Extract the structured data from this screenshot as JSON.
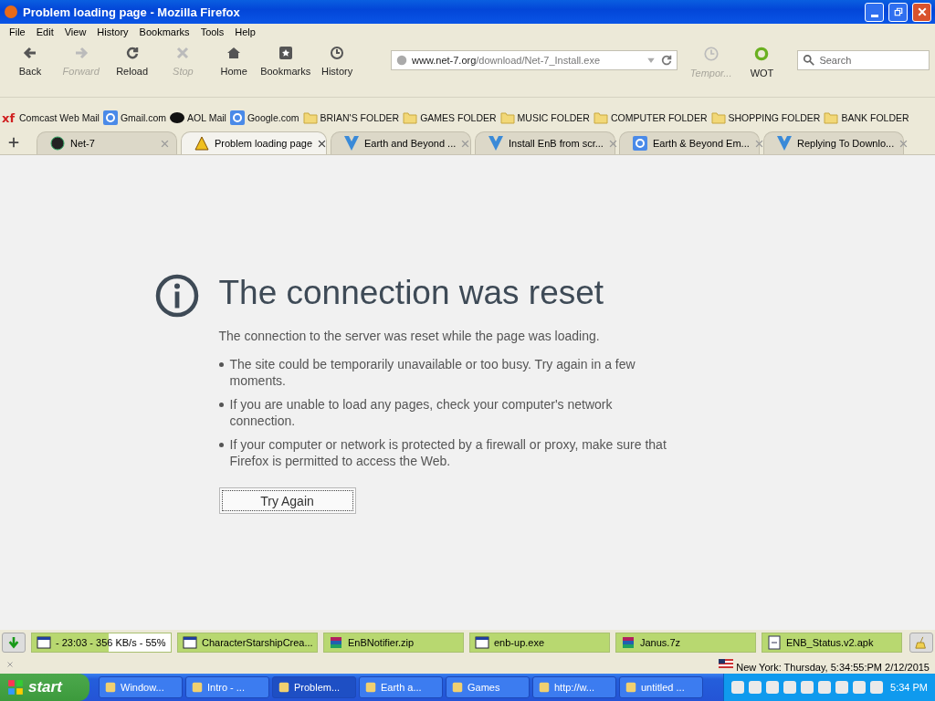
{
  "window": {
    "title": "Problem loading page - Mozilla Firefox"
  },
  "menu": [
    "File",
    "Edit",
    "View",
    "History",
    "Bookmarks",
    "Tools",
    "Help"
  ],
  "toolbar": [
    {
      "kind": "back",
      "label": "Back",
      "disabled": false
    },
    {
      "kind": "forward",
      "label": "Forward",
      "disabled": true
    },
    {
      "kind": "reload",
      "label": "Reload",
      "disabled": false
    },
    {
      "kind": "stop",
      "label": "Stop",
      "disabled": true
    },
    {
      "kind": "home",
      "label": "Home",
      "disabled": false
    },
    {
      "kind": "bookmarks",
      "label": "Bookmarks",
      "disabled": false
    },
    {
      "kind": "history",
      "label": "History",
      "disabled": false
    }
  ],
  "address": {
    "host": "www.net-7.org",
    "path": "/download/Net-7_Install.exe"
  },
  "addons": [
    {
      "kind": "tempor",
      "label": "Tempor...",
      "disabled": true
    },
    {
      "kind": "wot",
      "label": "WOT",
      "disabled": false
    }
  ],
  "search": {
    "placeholder": "Search"
  },
  "bookmarks": [
    {
      "kind": "xf",
      "label": "Comcast Web Mail"
    },
    {
      "kind": "g",
      "label": "Gmail.com"
    },
    {
      "kind": "aol",
      "label": "AOL Mail"
    },
    {
      "kind": "g",
      "label": "Google.com"
    },
    {
      "kind": "folder",
      "label": "BRIAN'S FOLDER"
    },
    {
      "kind": "folder",
      "label": "GAMES FOLDER"
    },
    {
      "kind": "folder",
      "label": "MUSIC FOLDER"
    },
    {
      "kind": "folder",
      "label": "COMPUTER FOLDER"
    },
    {
      "kind": "folder",
      "label": "SHOPPING FOLDER"
    },
    {
      "kind": "folder",
      "label": "BANK FOLDER"
    }
  ],
  "tabs": [
    {
      "kind": "net7",
      "label": "Net-7",
      "selected": false
    },
    {
      "kind": "warn",
      "label": "Problem loading page",
      "selected": true
    },
    {
      "kind": "v",
      "label": "Earth and Beyond ...",
      "selected": false
    },
    {
      "kind": "v",
      "label": "Install EnB from scr...",
      "selected": false
    },
    {
      "kind": "g",
      "label": "Earth & Beyond Em...",
      "selected": false
    },
    {
      "kind": "v",
      "label": "Replying To Downlo...",
      "selected": false
    }
  ],
  "error": {
    "title": "The connection was reset",
    "intro": "The connection to the server was reset while the page was loading.",
    "bullets": [
      "The site could be temporarily unavailable or too busy. Try again in a few moments.",
      "If you are unable to load any pages, check your computer's network connection.",
      "If your computer or network is protected by a firewall or proxy, make sure that Firefox is permitted to access the Web."
    ],
    "button": "Try Again"
  },
  "downloads": [
    {
      "kind": "window",
      "label": "- 23:03 - 356 KB/s - 55%",
      "level": 0.55
    },
    {
      "kind": "window",
      "label": "CharacterStarshipCrea..."
    },
    {
      "kind": "archive",
      "label": "EnBNotifier.zip"
    },
    {
      "kind": "window",
      "label": "enb-up.exe"
    },
    {
      "kind": "archive",
      "label": "Janus.7z"
    },
    {
      "kind": "file",
      "label": "ENB_Status.v2.apk"
    }
  ],
  "status_bar": {
    "clock": "New York: Thursday, 5:34:55:PM 2/12/2015"
  },
  "taskbar": {
    "start": "start",
    "items": [
      {
        "label": "Window...",
        "selected": false
      },
      {
        "label": "Intro - ...",
        "selected": false
      },
      {
        "label": "Problem...",
        "selected": true
      },
      {
        "label": "Earth a...",
        "selected": false
      },
      {
        "label": "Games",
        "selected": false
      },
      {
        "label": "http://w...",
        "selected": false
      },
      {
        "label": "untitled ...",
        "selected": false
      }
    ],
    "time": "5:34 PM"
  }
}
